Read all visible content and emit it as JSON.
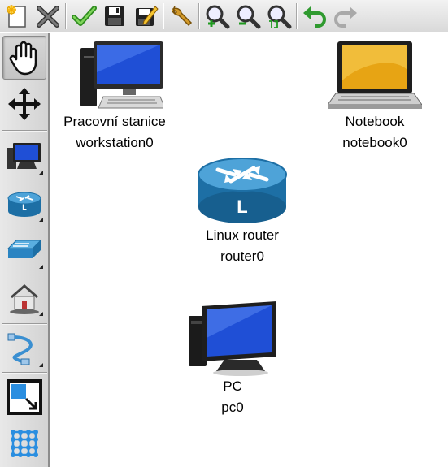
{
  "toolbar": {
    "buttons": [
      {
        "icon": "new-file-icon"
      },
      {
        "icon": "delete-x-icon"
      },
      {
        "icon": "check-icon"
      },
      {
        "icon": "save-icon"
      },
      {
        "icon": "save-as-icon"
      },
      {
        "icon": "wrench-icon"
      },
      {
        "icon": "zoom-in-icon"
      },
      {
        "icon": "zoom-out-icon"
      },
      {
        "icon": "zoom-reset-icon"
      },
      {
        "icon": "undo-icon"
      },
      {
        "icon": "redo-icon"
      }
    ]
  },
  "palette": {
    "items": [
      {
        "icon": "hand-icon",
        "active": true
      },
      {
        "icon": "move-arrows-icon"
      },
      {
        "icon": "computer-palette-icon"
      },
      {
        "icon": "router-palette-icon"
      },
      {
        "icon": "switch-palette-icon"
      },
      {
        "icon": "home-network-icon"
      },
      {
        "icon": "cable-icon"
      },
      {
        "icon": "resize-icon"
      },
      {
        "icon": "grid-icon"
      }
    ]
  },
  "canvas": {
    "nodes": {
      "workstation": {
        "type_label": "Pracovní stanice",
        "name": "workstation0"
      },
      "notebook": {
        "type_label": "Notebook",
        "name": "notebook0"
      },
      "router": {
        "type_label": "Linux router",
        "name": "router0"
      },
      "pc": {
        "type_label": "PC",
        "name": "pc0"
      }
    }
  },
  "colors": {
    "screen_blue": "#1f4fd6",
    "router_blue": "#2a7fb8",
    "undo_green": "#2f9a2f"
  }
}
